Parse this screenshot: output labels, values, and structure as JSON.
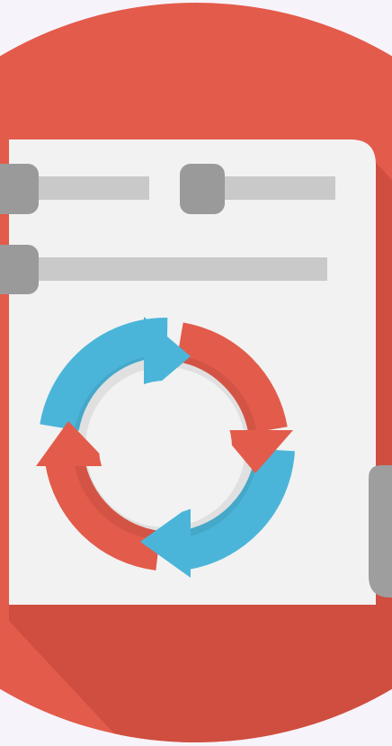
{
  "icon": {
    "name": "sync-settings-icon",
    "colors": {
      "background": "#f7f3fb",
      "circle": "#e35b4a",
      "shadow": "#cf4e3f",
      "panel": "#f2f2f2",
      "slider_track": "#c9c9c9",
      "slider_knob": "#9a9a9a",
      "arrow_blue": "#4bb5d9",
      "arrow_red": "#e35b4a",
      "arrow_inner_shadow": "#3e9fbf",
      "scrollbar": "#9e9e9e"
    },
    "sliders": [
      {
        "name": "slider-top-left",
        "level": 0.0
      },
      {
        "name": "slider-top-right",
        "level": 0.0
      },
      {
        "name": "slider-wide",
        "level": 0.0
      }
    ]
  }
}
